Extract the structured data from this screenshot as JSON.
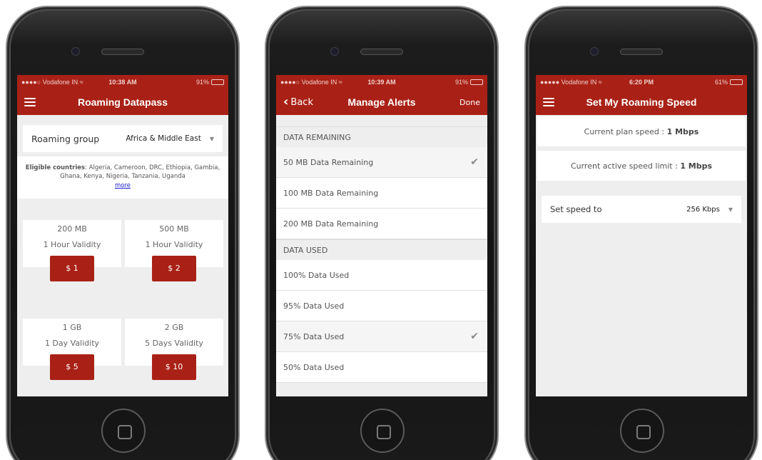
{
  "colors": {
    "accent": "#a92116",
    "battery_green": "#4cd964",
    "link_blue": "#1a1ad1"
  },
  "screen1": {
    "status": {
      "carrier": "●●●●○ Vodafone IN ≈",
      "time": "10:38 AM",
      "battery": "91%",
      "battery_level": 0.91
    },
    "nav": {
      "title": "Roaming Datapass",
      "menu_icon": "hamburger-icon"
    },
    "roaming_group": {
      "label": "Roaming group",
      "value": "Africa & Middle East"
    },
    "eligible": {
      "label": "Eligible countries",
      "countries": ": Algeria, Cameroon, DRC, Ethiopia, Gambia, Ghana, Kenya, Nigeria, Tanzania, Uganda",
      "more": "more"
    },
    "plans": [
      {
        "size": "200 MB",
        "validity": "1 Hour Validity",
        "price": "$ 1"
      },
      {
        "size": "500 MB",
        "validity": "1 Hour Validity",
        "price": "$ 2"
      },
      {
        "size": "1 GB",
        "validity": "1 Day Validity",
        "price": "$ 5"
      },
      {
        "size": "2 GB",
        "validity": "5 Days Validity",
        "price": "$ 10"
      }
    ]
  },
  "screen2": {
    "status": {
      "carrier": "●●●●○ Vodafone IN ≈",
      "time": "10:39 AM",
      "battery": "91%",
      "battery_level": 0.91
    },
    "nav": {
      "back": "Back",
      "title": "Manage Alerts",
      "done": "Done"
    },
    "sections": [
      {
        "header": "DATA REMAINING",
        "items": [
          {
            "label": "50 MB Data Remaining",
            "checked": true
          },
          {
            "label": "100 MB Data Remaining",
            "checked": false
          },
          {
            "label": "200 MB Data Remaining",
            "checked": false
          }
        ]
      },
      {
        "header": "DATA USED",
        "items": [
          {
            "label": "100% Data Used",
            "checked": false
          },
          {
            "label": "95% Data Used",
            "checked": false
          },
          {
            "label": "75% Data Used",
            "checked": true
          },
          {
            "label": "50% Data Used",
            "checked": false
          }
        ]
      }
    ]
  },
  "screen3": {
    "status": {
      "carrier": "●●●●● Vodafone IN ≈",
      "time": "6:20 PM",
      "battery": "61%",
      "battery_level": 0.61
    },
    "nav": {
      "title": "Set My Roaming Speed",
      "menu_icon": "hamburger-icon"
    },
    "current_plan": {
      "label": "Current plan speed :",
      "value": "1 Mbps"
    },
    "active_limit": {
      "label": "Current active speed limit :",
      "value": "1 Mbps"
    },
    "set_speed": {
      "label": "Set speed to",
      "value": "256 Kbps"
    }
  }
}
